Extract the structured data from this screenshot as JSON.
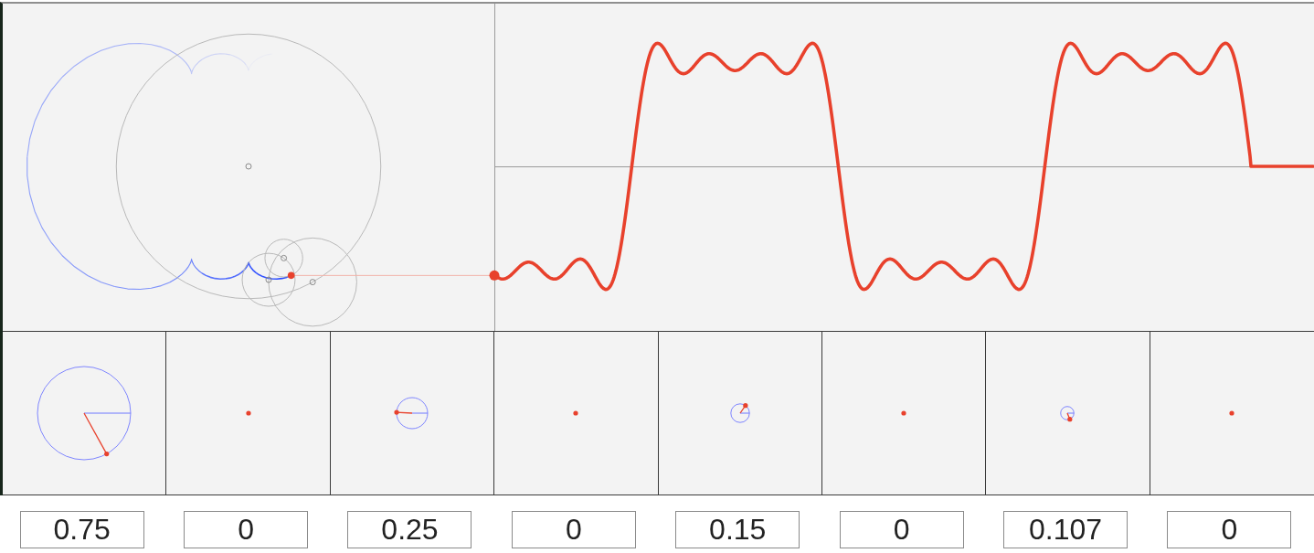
{
  "terms": [
    {
      "value": "0.75"
    },
    {
      "value": "0"
    },
    {
      "value": "0.25"
    },
    {
      "value": "0"
    },
    {
      "value": "0.15"
    },
    {
      "value": "0"
    },
    {
      "value": "0.107"
    },
    {
      "value": "0"
    }
  ]
}
